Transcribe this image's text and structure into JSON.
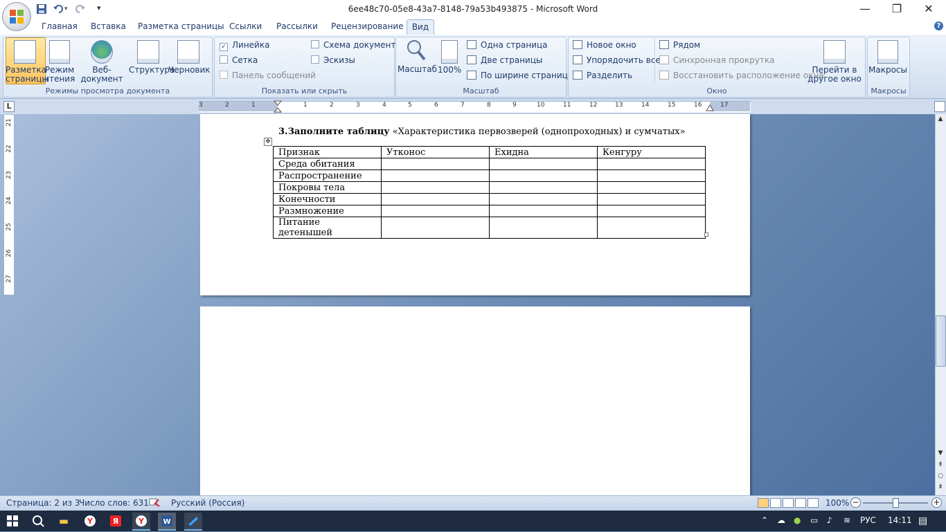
{
  "window": {
    "title": "6ee48c70-05e8-43a7-8148-79a53b493875 - Microsoft Word",
    "minimize_glyph": "—",
    "restore_glyph": "❐",
    "close_glyph": "✕"
  },
  "qat": {
    "save_icon": "save-icon",
    "undo_icon": "undo-icon",
    "redo_icon": "redo-icon",
    "customize_glyph": "▾"
  },
  "tabs": [
    "Главная",
    "Вставка",
    "Разметка страницы",
    "Ссылки",
    "Рассылки",
    "Рецензирование",
    "Вид"
  ],
  "active_tab": "Вид",
  "help_glyph": "?",
  "ribbon": {
    "views_group": {
      "label": "Режимы просмотра документа",
      "print_layout": "Разметка страницы",
      "reading": "Режим чтения",
      "web": "Веб-документ",
      "outline": "Структура",
      "draft": "Черновик"
    },
    "show_group": {
      "label": "Показать или скрыть",
      "ruler": "Линейка",
      "gridlines": "Сетка",
      "message_bar": "Панель сообщений",
      "doc_map": "Схема документа",
      "thumbnails": "Эскизы",
      "ruler_checked_glyph": "✓"
    },
    "zoom_group": {
      "label": "Масштаб",
      "zoom": "Масштаб",
      "hundred": "100%",
      "one_page": "Одна страница",
      "two_pages": "Две страницы",
      "page_width": "По ширине страницы"
    },
    "window_group": {
      "label": "Окно",
      "new_window": "Новое окно",
      "arrange_all": "Упорядочить все",
      "split": "Разделить",
      "side_by_side": "Рядом",
      "sync_scroll": "Синхронная прокрутка",
      "reset_position": "Восстановить расположение окна",
      "switch_windows": "Перейти в другое окно"
    },
    "macros_group": {
      "label": "Макросы",
      "macros": "Макросы"
    }
  },
  "ruler": {
    "corner": "L",
    "ticks": [
      "3",
      "2",
      "1",
      "1",
      "2",
      "3",
      "4",
      "5",
      "6",
      "7",
      "8",
      "9",
      "10",
      "11",
      "12",
      "13",
      "14",
      "15",
      "16",
      "17"
    ],
    "vticks": [
      "21",
      "22",
      "23",
      "24",
      "25",
      "26",
      "27"
    ]
  },
  "document": {
    "heading_bold": "3.Заполните таблицу",
    "heading_rest": " «Характеристика первозверей (однопроходных) и сумчатых»",
    "table_headers": [
      "Признак",
      "Утконос",
      "Ехидна",
      "Кенгуру"
    ],
    "table_rows": [
      [
        "Среда обитания",
        "",
        "",
        ""
      ],
      [
        "Распространение",
        "",
        "",
        ""
      ],
      [
        "Покровы тела",
        "",
        "",
        ""
      ],
      [
        "Конечности",
        "",
        "",
        ""
      ],
      [
        "Размножение",
        "",
        "",
        ""
      ],
      [
        "Питание детенышей",
        "",
        "",
        ""
      ]
    ],
    "move_handle_glyph": "✥"
  },
  "status": {
    "page": "Страница: 2 из 3",
    "words": "Число слов: 631",
    "language": "Русский (Россия)",
    "zoom": "100%",
    "zoom_minus": "−",
    "zoom_plus": "+"
  },
  "taskbar": {
    "lang": "РУС",
    "time": "14:11"
  }
}
